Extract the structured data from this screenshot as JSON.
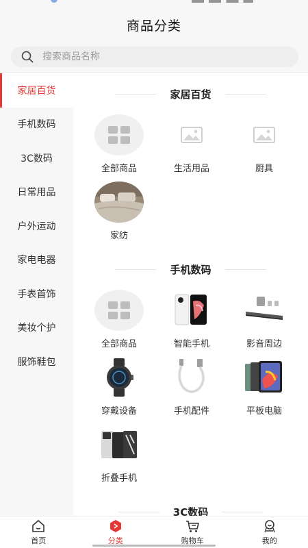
{
  "header": {
    "title": "商品分类"
  },
  "search": {
    "placeholder": "搜索商品名称"
  },
  "sidebar": {
    "items": [
      {
        "label": "家居百货",
        "active": true
      },
      {
        "label": "手机数码",
        "active": false
      },
      {
        "label": "3C数码",
        "active": false
      },
      {
        "label": "日常用品",
        "active": false
      },
      {
        "label": "户外运动",
        "active": false
      },
      {
        "label": "家电电器",
        "active": false
      },
      {
        "label": "手表首饰",
        "active": false
      },
      {
        "label": "美妆个护",
        "active": false
      },
      {
        "label": "服饰鞋包",
        "active": false
      }
    ]
  },
  "sections": [
    {
      "title": "家居百货",
      "items": [
        {
          "label": "全部商品",
          "icon": "grid-icon"
        },
        {
          "label": "生活用品",
          "icon": "image-placeholder-icon"
        },
        {
          "label": "厨具",
          "icon": "image-placeholder-icon"
        },
        {
          "label": "家纺",
          "icon": "bedding-photo"
        }
      ]
    },
    {
      "title": "手机数码",
      "items": [
        {
          "label": "全部商品",
          "icon": "grid-icon"
        },
        {
          "label": "智能手机",
          "icon": "smartphone-photo"
        },
        {
          "label": "影音周边",
          "icon": "speaker-photo"
        },
        {
          "label": "穿戴设备",
          "icon": "smartwatch-photo"
        },
        {
          "label": "手机配件",
          "icon": "cable-photo"
        },
        {
          "label": "平板电脑",
          "icon": "tablet-photo"
        },
        {
          "label": "折叠手机",
          "icon": "foldable-phone-photo"
        }
      ]
    },
    {
      "title": "3C数码",
      "items": []
    }
  ],
  "tabbar": {
    "items": [
      {
        "label": "首页",
        "icon": "home-icon",
        "active": false
      },
      {
        "label": "分类",
        "icon": "category-icon",
        "active": true
      },
      {
        "label": "购物车",
        "icon": "cart-icon",
        "active": false
      },
      {
        "label": "我的",
        "icon": "profile-icon",
        "active": false
      }
    ]
  },
  "colors": {
    "accent": "#e53935",
    "background": "#f7f7f7"
  }
}
